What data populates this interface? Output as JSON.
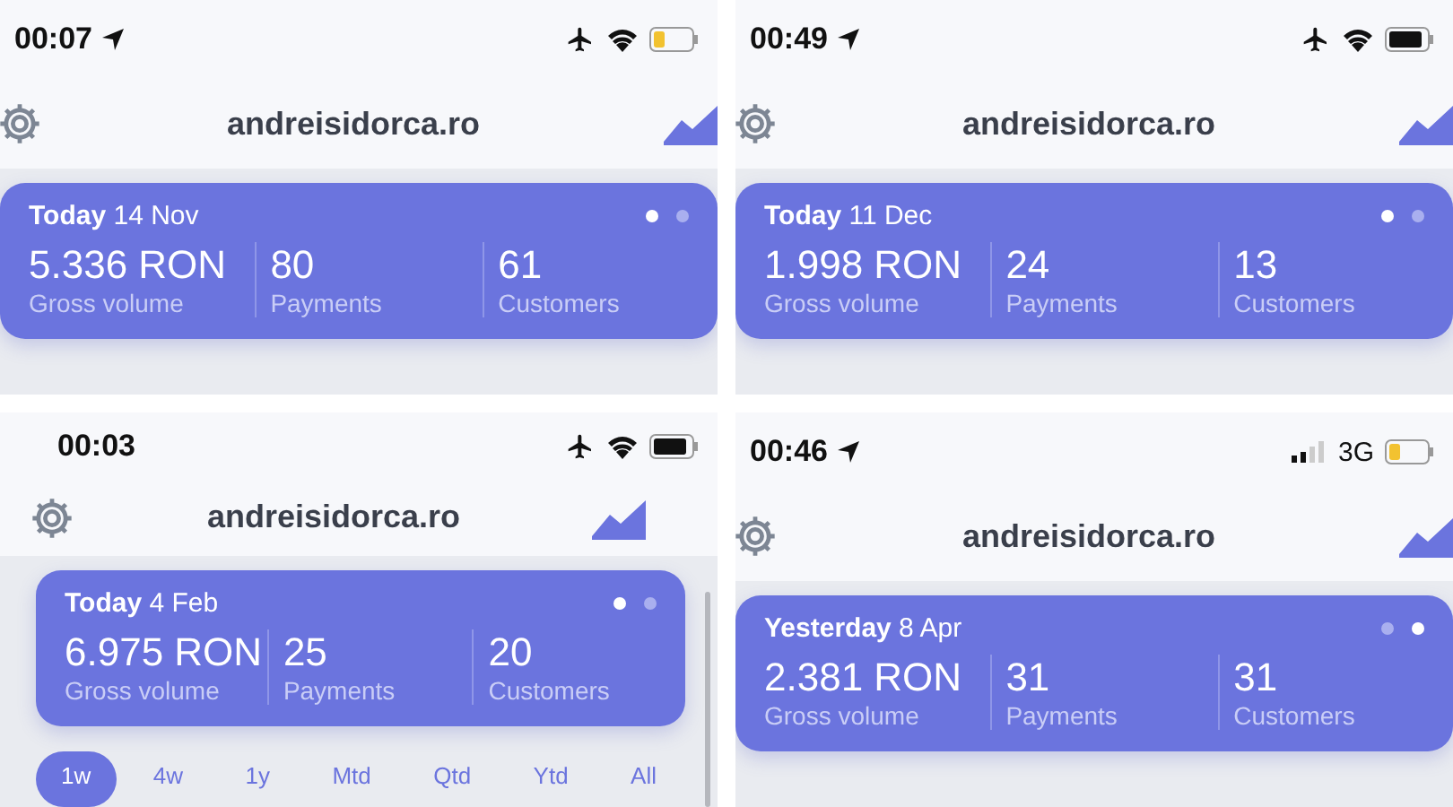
{
  "panels": [
    {
      "time": "00:07",
      "location": true,
      "wifi": true,
      "battery_low": true,
      "site": "andreisidorca.ro",
      "card": {
        "day": "Today",
        "date": "14 Nov",
        "pages": [
          {
            "selected": true
          },
          {
            "selected": false
          }
        ],
        "metrics": [
          {
            "value": "5.336 RON",
            "label": "Gross volume"
          },
          {
            "value": "80",
            "label": "Payments"
          },
          {
            "value": "61",
            "label": "Customers"
          }
        ]
      }
    },
    {
      "time": "00:49",
      "location": true,
      "wifi": true,
      "battery_low": false,
      "site": "andreisidorca.ro",
      "card": {
        "day": "Today",
        "date": "11 Dec",
        "pages": [
          {
            "selected": true
          },
          {
            "selected": false
          }
        ],
        "metrics": [
          {
            "value": "1.998 RON",
            "label": "Gross volume"
          },
          {
            "value": "24",
            "label": "Payments"
          },
          {
            "value": "13",
            "label": "Customers"
          }
        ]
      }
    },
    {
      "time": "00:03",
      "location": false,
      "wifi": true,
      "battery_low": false,
      "site": "andreisidorca.ro",
      "card": {
        "day": "Today",
        "date": "4 Feb",
        "pages": [
          {
            "selected": true
          },
          {
            "selected": false
          }
        ],
        "metrics": [
          {
            "value": "6.975 RON",
            "label": "Gross volume"
          },
          {
            "value": "25",
            "label": "Payments"
          },
          {
            "value": "20",
            "label": "Customers"
          }
        ]
      },
      "ranges": [
        {
          "label": "1w",
          "selected": true
        },
        {
          "label": "4w",
          "selected": false
        },
        {
          "label": "1y",
          "selected": false
        },
        {
          "label": "Mtd",
          "selected": false
        },
        {
          "label": "Qtd",
          "selected": false
        },
        {
          "label": "Ytd",
          "selected": false
        },
        {
          "label": "All",
          "selected": false
        }
      ]
    },
    {
      "time": "00:46",
      "location": true,
      "wifi": false,
      "network_label": "3G",
      "battery_low": true,
      "site": "andreisidorca.ro",
      "card": {
        "day": "Yesterday",
        "date": "8 Apr",
        "pages": [
          {
            "selected": false
          },
          {
            "selected": true
          }
        ],
        "metrics": [
          {
            "value": "2.381 RON",
            "label": "Gross volume"
          },
          {
            "value": "31",
            "label": "Payments"
          },
          {
            "value": "31",
            "label": "Customers"
          }
        ]
      }
    }
  ]
}
